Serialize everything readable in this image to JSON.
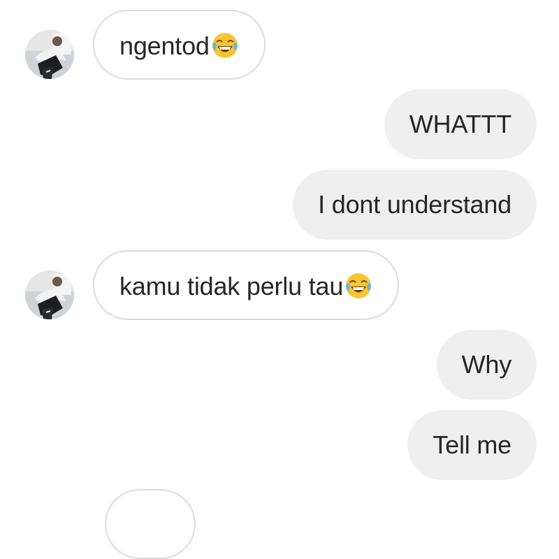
{
  "messages": [
    {
      "side": "in",
      "text": "ngentod",
      "emoji": "face-with-tears-of-joy"
    },
    {
      "side": "out",
      "text": "WHATTT"
    },
    {
      "side": "out",
      "text": "I dont understand"
    },
    {
      "side": "in",
      "text": "kamu tidak perlu tau",
      "emoji": "face-with-tears-of-joy"
    },
    {
      "side": "out",
      "text": "Why"
    },
    {
      "side": "out",
      "text": "Tell me"
    }
  ],
  "colors": {
    "incoming_bubble_bg": "#ffffff",
    "incoming_bubble_border": "#dbdbdb",
    "outgoing_bubble_bg": "#efefef",
    "text": "#262626"
  }
}
